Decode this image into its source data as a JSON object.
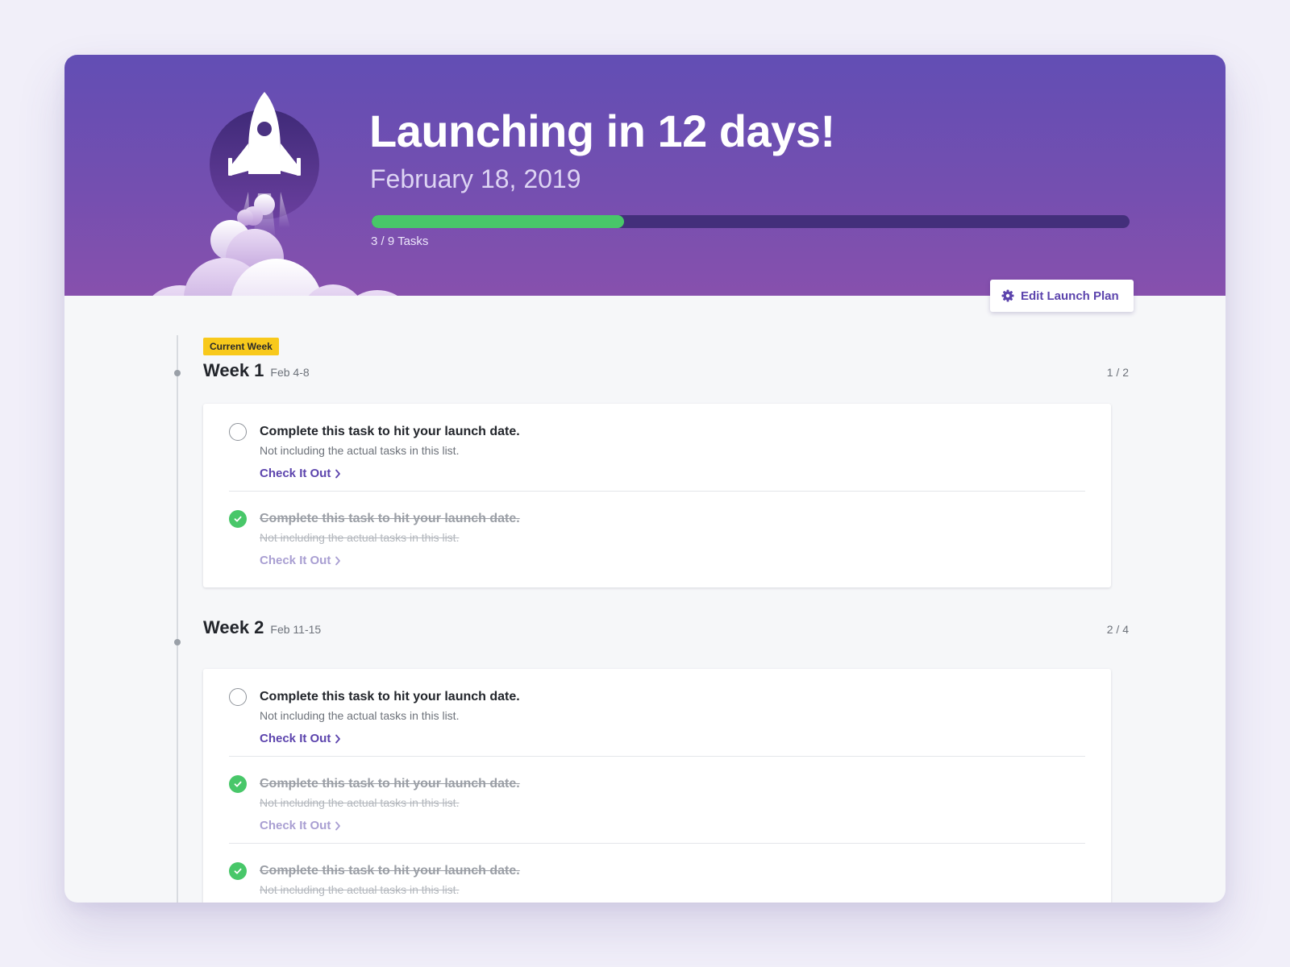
{
  "header": {
    "title": "Launching in 12 days!",
    "date": "February 18, 2019",
    "progress": {
      "completed": 3,
      "total": 9,
      "label": "3 / 9 Tasks",
      "fill_color": "#48c769",
      "track_color": "#432f7b"
    },
    "edit_button_label": "Edit Launch Plan",
    "edit_button_icon": "gear-icon",
    "illustration": "rocket-icon"
  },
  "current_week_badge": "Current Week",
  "weeks": [
    {
      "title": "Week 1",
      "dates": "Feb 4-8",
      "count": "1 / 2",
      "tasks": [
        {
          "title": "Complete this task to hit your launch date.",
          "description": "Not including the actual tasks in this list.",
          "link": "Check It Out",
          "done": false
        },
        {
          "title": "Complete this task to hit your launch date.",
          "description": "Not including the actual tasks in this list.",
          "link": "Check It Out",
          "done": true
        }
      ]
    },
    {
      "title": "Week 2",
      "dates": "Feb 11-15",
      "count": "2 / 4",
      "tasks": [
        {
          "title": "Complete this task to hit your launch date.",
          "description": "Not including the actual tasks in this list.",
          "link": "Check It Out",
          "done": false
        },
        {
          "title": "Complete this task to hit your launch date.",
          "description": "Not including the actual tasks in this list.",
          "link": "Check It Out",
          "done": true
        },
        {
          "title": "Complete this task to hit your launch date.",
          "description": "Not including the actual tasks in this list.",
          "done": true
        }
      ]
    }
  ],
  "colors": {
    "accent": "#5c44ad",
    "hero_top": "#624eb4",
    "hero_bottom": "#8750ad",
    "done": "#48c769",
    "badge": "#f8c91c"
  }
}
